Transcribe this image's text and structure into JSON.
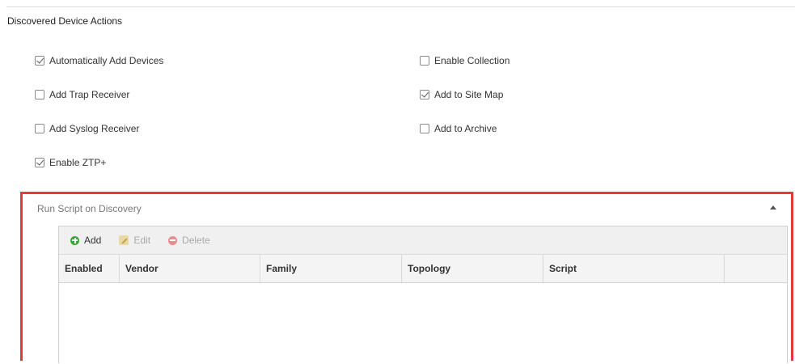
{
  "section": {
    "title": "Discovered Device Actions"
  },
  "options": [
    {
      "label": "Automatically Add Devices",
      "checked": true
    },
    {
      "label": "Enable Collection",
      "checked": false
    },
    {
      "label": "Add Trap Receiver",
      "checked": false
    },
    {
      "label": "Add to Site Map",
      "checked": true
    },
    {
      "label": "Add Syslog Receiver",
      "checked": false
    },
    {
      "label": "Add to Archive",
      "checked": false
    },
    {
      "label": "Enable ZTP+",
      "checked": true
    }
  ],
  "panel": {
    "title": "Run Script on Discovery",
    "collapse_icon": "triangle-up-icon"
  },
  "toolbar": {
    "add": "Add",
    "edit": "Edit",
    "delete": "Delete"
  },
  "table": {
    "columns": [
      "Enabled",
      "Vendor",
      "Family",
      "Topology",
      "Script",
      ""
    ],
    "rows": []
  },
  "colors": {
    "highlight": "#e0393e",
    "add": "#3aa538",
    "delete": "#e88d8d"
  }
}
